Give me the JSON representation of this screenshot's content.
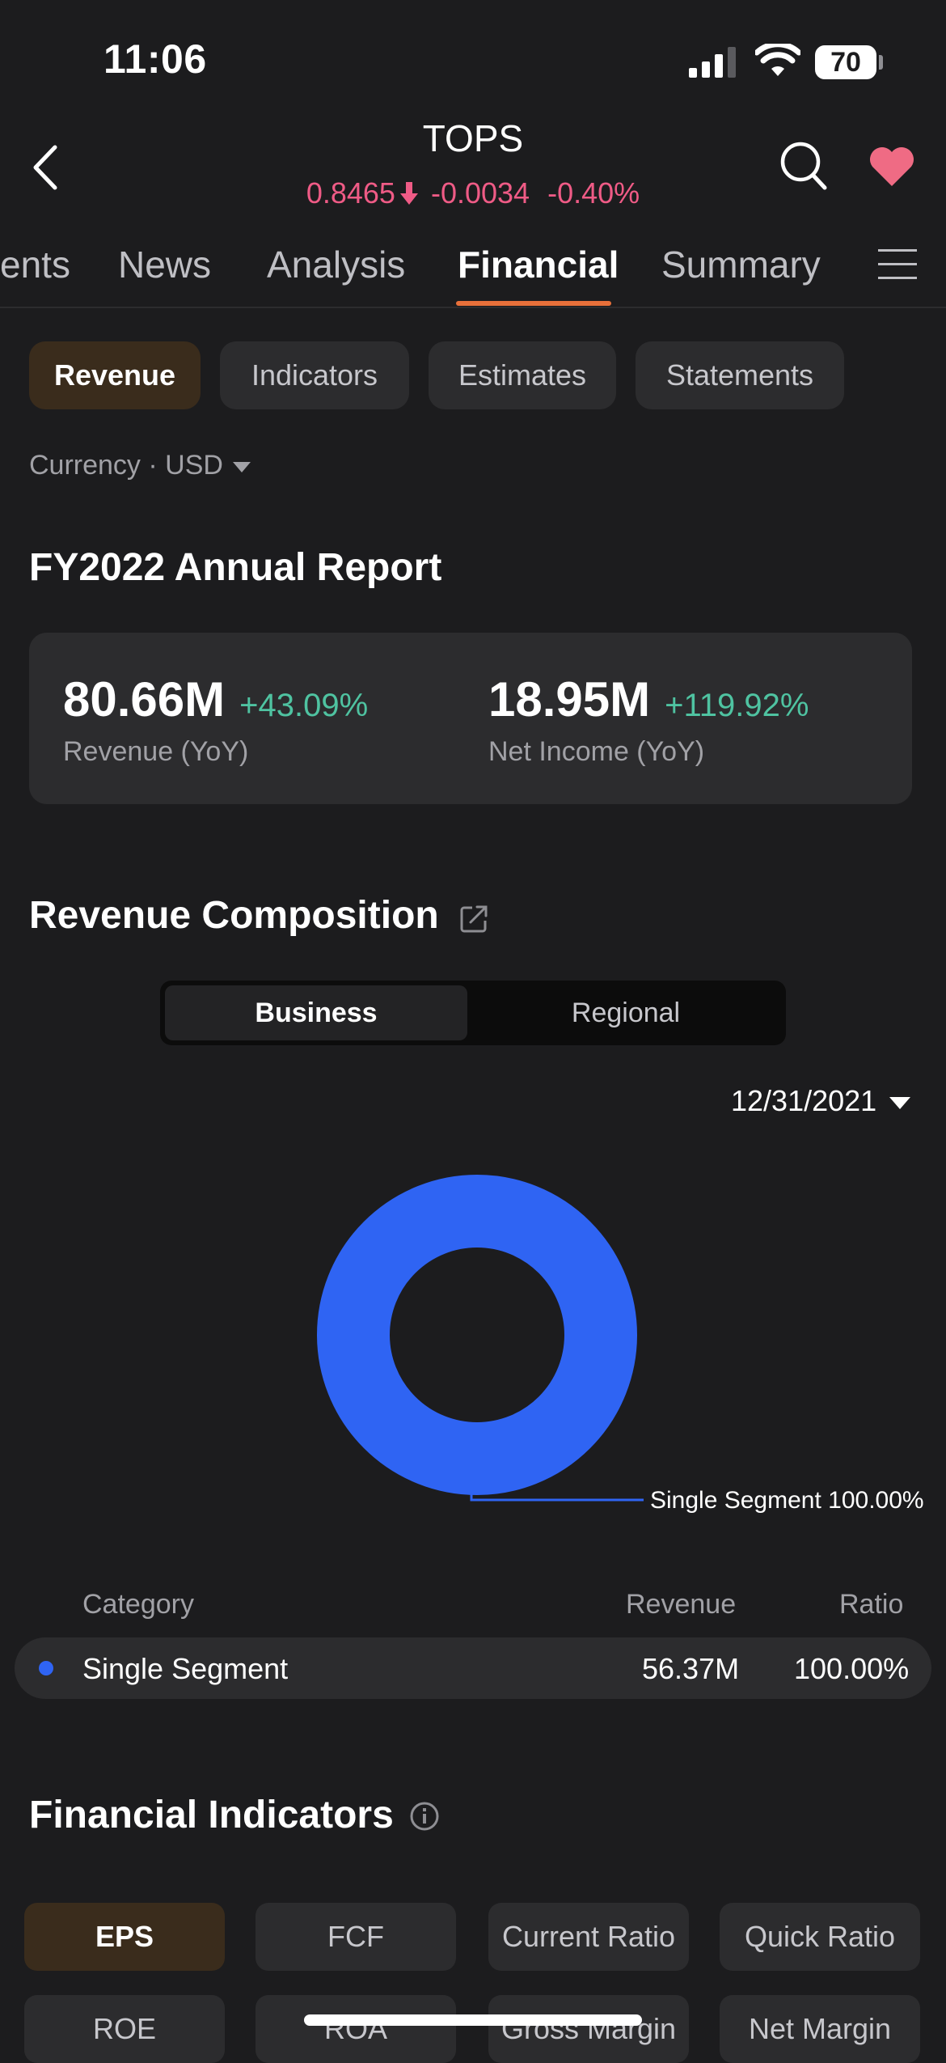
{
  "status_bar": {
    "time": "11:06",
    "battery": "70"
  },
  "header": {
    "ticker": "TOPS",
    "price": "0.8465",
    "change": "-0.0034",
    "change_pct": "-0.40%",
    "down_color": "#ef5b86"
  },
  "tabs": [
    {
      "label": "ents"
    },
    {
      "label": "News"
    },
    {
      "label": "Analysis"
    },
    {
      "label": "Financial",
      "active": true
    },
    {
      "label": "Summary"
    }
  ],
  "sub_tabs": [
    {
      "label": "Revenue",
      "active": true
    },
    {
      "label": "Indicators"
    },
    {
      "label": "Estimates"
    },
    {
      "label": "Statements"
    }
  ],
  "currency": "Currency · USD",
  "annual_report": {
    "title": "FY2022 Annual Report",
    "revenue_value": "80.66M",
    "revenue_change": "+43.09%",
    "revenue_label": "Revenue (YoY)",
    "net_income_value": "18.95M",
    "net_income_change": "+119.92%",
    "net_income_label": "Net Income (YoY)",
    "up_color": "#4fc3a1"
  },
  "revenue_composition": {
    "title": "Revenue Composition",
    "toggle": {
      "business": "Business",
      "regional": "Regional",
      "selected": "Business"
    },
    "date": "12/31/2021",
    "donut_label": "Single Segment 100.00%",
    "table": {
      "headers": [
        "Category",
        "Revenue",
        "Ratio"
      ],
      "rows": [
        {
          "category": "Single Segment",
          "revenue": "56.37M",
          "ratio": "100.00%",
          "color": "#2f64f3"
        }
      ]
    }
  },
  "chart_data": {
    "type": "pie",
    "style": "donut",
    "categories": [
      "Single Segment"
    ],
    "values": [
      100.0
    ],
    "colors": [
      "#2f64f3"
    ]
  },
  "financial_indicators": {
    "title": "Financial Indicators",
    "buttons": [
      {
        "label": "EPS",
        "active": true
      },
      {
        "label": "FCF"
      },
      {
        "label": "Current Ratio"
      },
      {
        "label": "Quick Ratio"
      },
      {
        "label": "ROE"
      },
      {
        "label": "ROA"
      },
      {
        "label": "Gross Margin"
      },
      {
        "label": "Net Margin"
      }
    ]
  },
  "icons": {
    "back": "chevron-left-icon",
    "search": "search-icon",
    "favorite": "heart-icon",
    "menu": "hamburger-menu-icon",
    "share": "share-icon",
    "info": "info-icon"
  }
}
